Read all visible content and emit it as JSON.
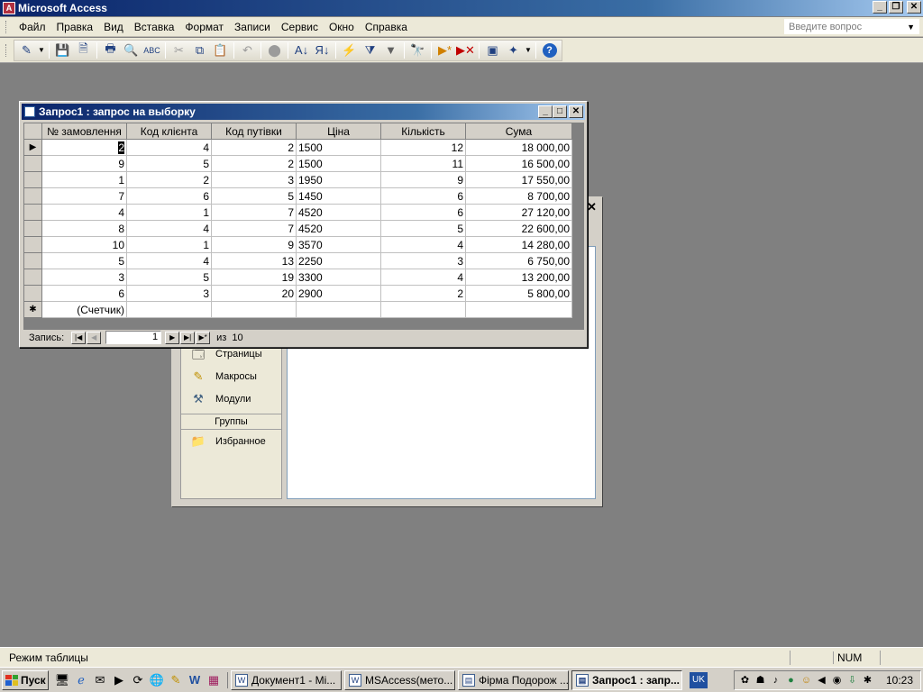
{
  "app": {
    "title": "Microsoft Access",
    "help_placeholder": "Введите вопрос"
  },
  "menu": [
    "Файл",
    "Правка",
    "Вид",
    "Вставка",
    "Формат",
    "Записи",
    "Сервис",
    "Окно",
    "Справка"
  ],
  "toolbar": {
    "buttons": [
      "view-design",
      "save",
      "print-setup",
      "print",
      "print-preview",
      "spell-check",
      "cut",
      "copy",
      "paste",
      "undo",
      "insert-object",
      "sort-ascending",
      "sort-descending",
      "filter-by-selection",
      "filter-by-form",
      "apply-filter",
      "find",
      "new-record",
      "delete-record",
      "database-window",
      "new-object",
      "help"
    ]
  },
  "query_window": {
    "title": "Запрос1 : запрос на выборку",
    "columns": [
      "№ замовлення",
      "Код клієнта",
      "Код путівки",
      "Ціна",
      "Кількість",
      "Сума"
    ],
    "rows": [
      [
        "2",
        "4",
        "2",
        "1500",
        "12",
        "18 000,00"
      ],
      [
        "9",
        "5",
        "2",
        "1500",
        "11",
        "16 500,00"
      ],
      [
        "1",
        "2",
        "3",
        "1950",
        "9",
        "17 550,00"
      ],
      [
        "7",
        "6",
        "5",
        "1450",
        "6",
        "8 700,00"
      ],
      [
        "4",
        "1",
        "7",
        "4520",
        "6",
        "27 120,00"
      ],
      [
        "8",
        "4",
        "7",
        "4520",
        "5",
        "22 600,00"
      ],
      [
        "10",
        "1",
        "9",
        "3570",
        "4",
        "14 280,00"
      ],
      [
        "5",
        "4",
        "13",
        "2250",
        "3",
        "6 750,00"
      ],
      [
        "3",
        "5",
        "19",
        "3300",
        "4",
        "13 200,00"
      ],
      [
        "6",
        "3",
        "20",
        "2900",
        "2",
        "5 800,00"
      ]
    ],
    "new_row_placeholder": "(Счетчик)",
    "nav": {
      "label": "Запись:",
      "current": "1",
      "of_label": "из",
      "total": "10"
    }
  },
  "db_window": {
    "objects": [
      "Страницы",
      "Макросы",
      "Модули"
    ],
    "groups_header": "Группы",
    "groups": [
      "Избранное"
    ]
  },
  "status": {
    "mode": "Режим таблицы",
    "num": "NUM"
  },
  "taskbar": {
    "start": "Пуск",
    "tasks": [
      "Документ1 - Mi...",
      "MSAccess(мето...",
      "Фірма Подорож ...",
      "Запрос1 : запр..."
    ],
    "lang": "UK",
    "clock": "10:23"
  }
}
